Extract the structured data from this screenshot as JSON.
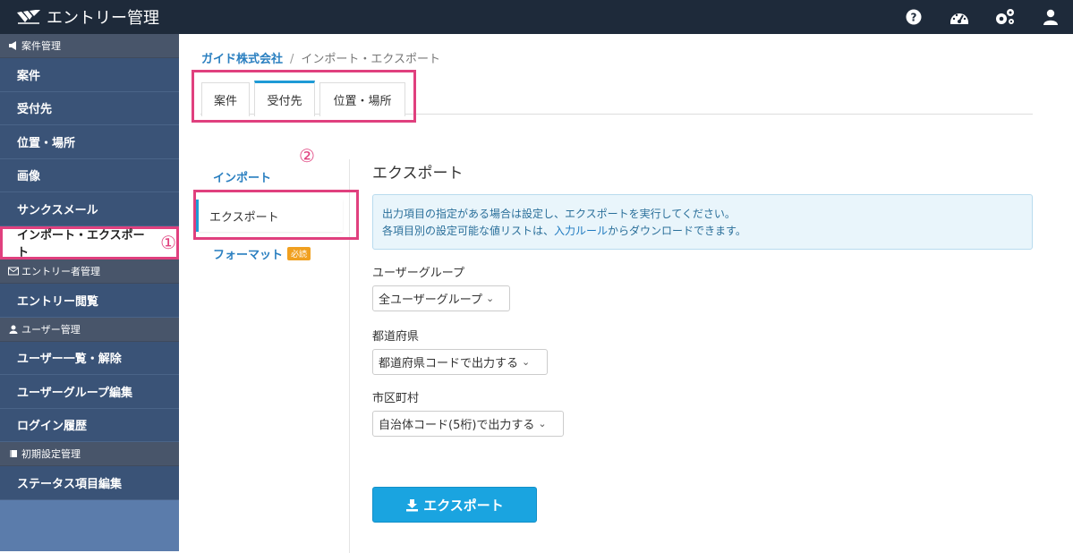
{
  "app": {
    "title": "エントリー管理"
  },
  "topbar": {
    "icons": [
      "help-icon",
      "dashboard-icon",
      "settings-icon",
      "user-icon"
    ]
  },
  "sidebar": {
    "groups": [
      {
        "header": "案件管理",
        "icon": "megaphone-icon",
        "items": [
          "案件",
          "受付先",
          "位置・場所",
          "画像",
          "サンクスメール",
          "インポート・エクスポート"
        ]
      },
      {
        "header": "エントリー者管理",
        "icon": "mail-icon",
        "items": [
          "エントリー閲覧"
        ]
      },
      {
        "header": "ユーザー管理",
        "icon": "person-icon",
        "items": [
          "ユーザー一覧・解除",
          "ユーザーグループ編集",
          "ログイン履歴"
        ]
      },
      {
        "header": "初期設定管理",
        "icon": "book-icon",
        "items": [
          "ステータス項目編集"
        ]
      }
    ],
    "active_marker": "①"
  },
  "breadcrumb": {
    "parent": "ガイド株式会社",
    "separator": "/",
    "current": "インポート・エクスポート"
  },
  "tabs": [
    {
      "label": "案件"
    },
    {
      "label": "受付先"
    },
    {
      "label": "位置・場所"
    }
  ],
  "subnav": {
    "marker": "②",
    "import": "インポート",
    "export": "エクスポート",
    "format": "フォーマット",
    "format_badge": "必読"
  },
  "content": {
    "title": "エクスポート",
    "info_line1": "出力項目の指定がある場合は設定し、エクスポートを実行してください。",
    "info_line2_pre": "各項目別の設定可能な値リストは、",
    "info_line2_link": "入力ルール",
    "info_line2_post": "からダウンロードできます。",
    "fields": [
      {
        "label": "ユーザーグループ",
        "value": "全ユーザーグループ"
      },
      {
        "label": "都道府県",
        "value": "都道府県コードで出力する"
      },
      {
        "label": "市区町村",
        "value": "自治体コード(5桁)で出力する"
      }
    ],
    "export_button": "エクスポート"
  },
  "colors": {
    "topbar": "#1e2a3a",
    "sidebar": "#3a5377",
    "accent": "#1aa4e0",
    "highlight": "#e0407e"
  }
}
